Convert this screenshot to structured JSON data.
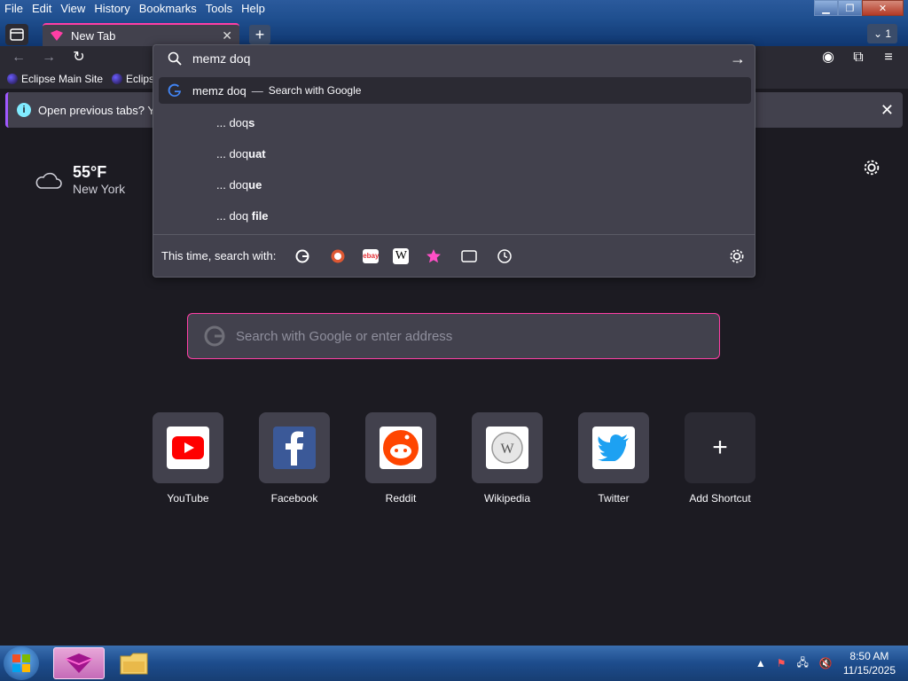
{
  "menu": [
    "File",
    "Edit",
    "View",
    "History",
    "Bookmarks",
    "Tools",
    "Help"
  ],
  "tab": {
    "title": "New Tab",
    "close": "✕"
  },
  "tabs_count": "1",
  "bookmarks": [
    "Eclipse Main Site",
    "Eclips"
  ],
  "infobar": {
    "text": "Open previous tabs? You"
  },
  "weather": {
    "temp": "55°F",
    "location": "New York"
  },
  "urlbar": {
    "query": "memz doq",
    "top_result": {
      "text": "memz doq",
      "separator": "—",
      "action": "Search with Google"
    },
    "suggestions": [
      {
        "prefix": "... doq",
        "bold": "s"
      },
      {
        "prefix": "... doq",
        "bold": "uat"
      },
      {
        "prefix": "... doq",
        "bold": "ue"
      },
      {
        "prefix": "... doq",
        "bold": " file"
      }
    ],
    "oneoff_label": "This time, search with:",
    "engines": [
      "google-icon",
      "duckduckgo-icon",
      "ebay-icon",
      "wikipedia-icon",
      "bookmarks-star-icon",
      "tabs-icon",
      "history-clock-icon"
    ]
  },
  "search": {
    "placeholder": "Search with Google or enter address"
  },
  "shortcuts": [
    {
      "label": "YouTube",
      "icon": "youtube-icon"
    },
    {
      "label": "Facebook",
      "icon": "facebook-icon"
    },
    {
      "label": "Reddit",
      "icon": "reddit-icon"
    },
    {
      "label": "Wikipedia",
      "icon": "wikipedia-icon"
    },
    {
      "label": "Twitter",
      "icon": "twitter-icon"
    },
    {
      "label": "Add Shortcut",
      "icon": "plus-icon"
    }
  ],
  "taskbar": {
    "time": "8:50 AM",
    "date": "11/15/2025"
  },
  "colors": {
    "accent": "#ff3ea5",
    "background": "#1c1b22",
    "panel": "#42414d"
  }
}
